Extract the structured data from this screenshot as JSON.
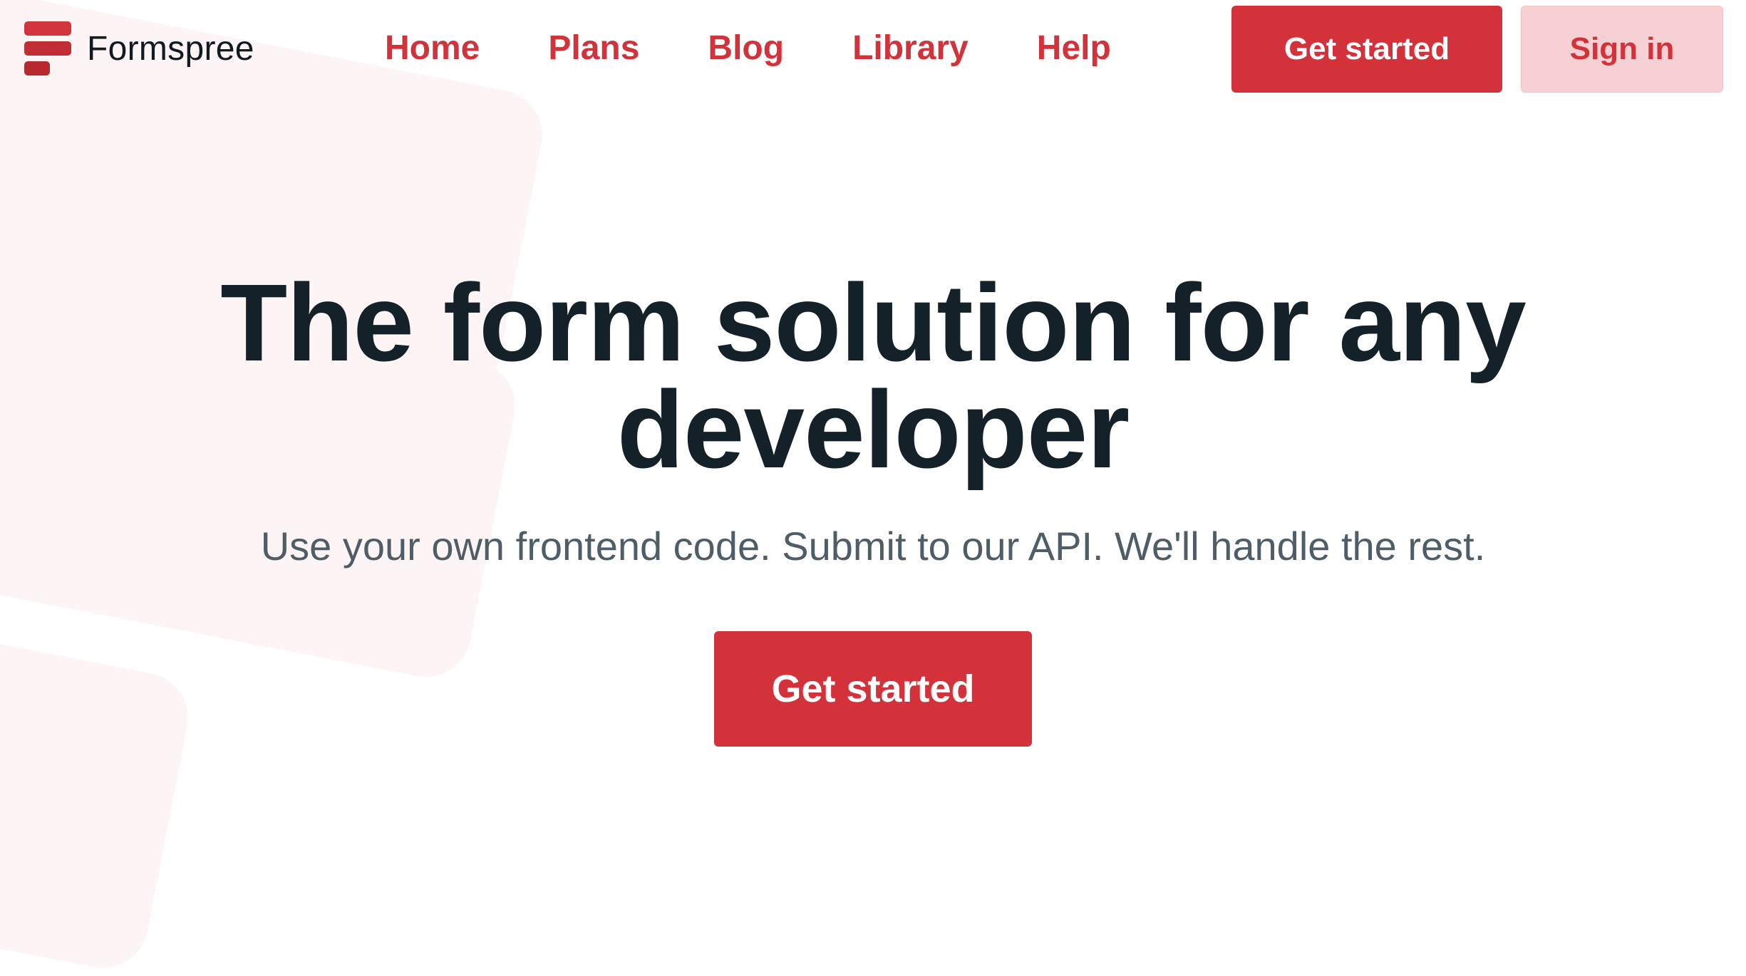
{
  "brand": {
    "name": "Formspree",
    "logo_icon": "formspree-logo-icon",
    "accent_color": "#d3323b",
    "text_color": "#152128"
  },
  "nav": {
    "items": [
      {
        "label": "Home"
      },
      {
        "label": "Plans"
      },
      {
        "label": "Blog"
      },
      {
        "label": "Library"
      },
      {
        "label": "Help"
      }
    ]
  },
  "header_actions": {
    "primary_label": "Get started",
    "secondary_label": "Sign in"
  },
  "hero": {
    "title_line1": "The form solution for any",
    "title_line2": "developer",
    "subtitle": "Use your own frontend code. Submit to our API. We'll handle the rest.",
    "cta_label": "Get started"
  }
}
